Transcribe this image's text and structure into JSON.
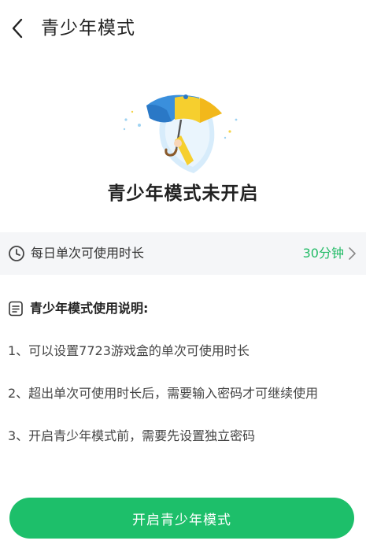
{
  "header": {
    "title": "青少年模式",
    "back_icon": "chevron-left-icon"
  },
  "hero": {
    "illustration": "umbrella-shield-illustration",
    "status_text": "青少年模式未开启"
  },
  "setting": {
    "icon": "clock-icon",
    "label": "每日单次可使用时长",
    "value": "30分钟",
    "chevron_icon": "chevron-right-icon"
  },
  "instructions": {
    "icon": "document-icon",
    "title": "青少年模式使用说明:",
    "items": [
      "1、可以设置7723游戏盒的单次可使用时长",
      "2、超出单次可使用时长后，需要输入密码才可继续使用",
      "3、开启青少年模式前，需要先设置独立密码"
    ]
  },
  "action": {
    "button_label": "开启青少年模式"
  },
  "colors": {
    "accent_green": "#1dbf6a",
    "value_green": "#22bb66",
    "row_background": "#f5f6f8"
  }
}
